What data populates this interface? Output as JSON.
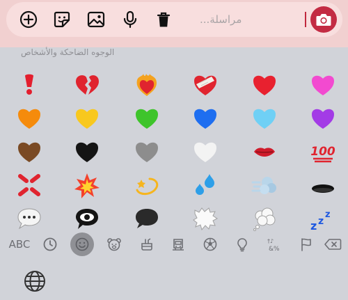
{
  "composer": {
    "placeholder": "مراسلة...",
    "icons": [
      "plus-circle-icon",
      "sticker-icon",
      "image-icon",
      "microphone-icon",
      "trash-icon",
      "camera-icon"
    ]
  },
  "keyboard": {
    "category_title": "الوجوه الضاحكة والأشخاص",
    "abc_label": "ABC",
    "emoji_rows": [
      [
        "❗",
        "💔",
        "❤️‍🔥",
        "❤️‍🩹",
        "❤️",
        "🩷"
      ],
      [
        "🧡",
        "💛",
        "💚",
        "💙",
        "🩵",
        "💜"
      ],
      [
        "🤎",
        "🖤",
        "🩶",
        "🤍",
        "💋",
        "💯"
      ],
      [
        "💢",
        "💥",
        "💫",
        "💦",
        "💨",
        "🕳️"
      ],
      [
        "💬",
        "👁️‍🗨️",
        "🗨️",
        "🗯️",
        "💭",
        "💤"
      ]
    ],
    "categories": [
      "recent-icon",
      "smileys-icon",
      "animals-icon",
      "food-icon",
      "travel-icon",
      "activity-icon",
      "objects-icon",
      "symbols-icon",
      "flags-icon",
      "delete-icon"
    ],
    "selected_category": "smileys-icon"
  },
  "colors": {
    "accent": "#c32b43",
    "composer_bg": "#f8dede",
    "keyboard_bg": "#d1d3d9"
  }
}
